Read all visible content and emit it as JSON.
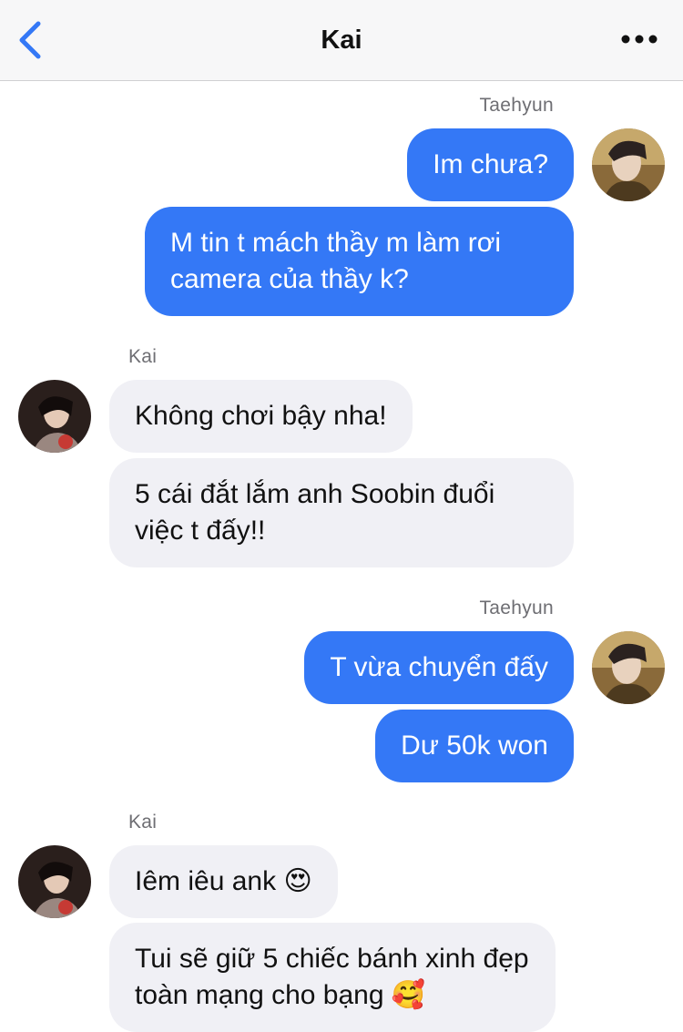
{
  "header": {
    "title": "Kai",
    "back_icon": "chevron-left-icon",
    "more_icon": "ellipsis-icon"
  },
  "colors": {
    "outgoing_bubble": "#3478f6",
    "incoming_bubble": "#f0f0f5",
    "accent": "#3478f6"
  },
  "groups": [
    {
      "sender": "Taehyun",
      "direction": "outgoing",
      "messages": [
        "Im chưa?",
        "M tin t mách thầy m làm rơi camera của thầy k?"
      ]
    },
    {
      "sender": "Kai",
      "direction": "incoming",
      "messages": [
        "Không chơi bậy nha!",
        "5 cái đắt lắm anh Soobin đuổi việc t đấy!!"
      ]
    },
    {
      "sender": "Taehyun",
      "direction": "outgoing",
      "messages": [
        "T vừa chuyển đấy",
        "Dư 50k won"
      ]
    },
    {
      "sender": "Kai",
      "direction": "incoming",
      "messages": [
        {
          "text": "Iêm iêu ank",
          "emoji": "😍"
        },
        {
          "text": "Tui sẽ giữ 5 chiếc bánh xinh đẹp toàn mạng cho bạng",
          "emoji": "🥰"
        }
      ]
    }
  ]
}
